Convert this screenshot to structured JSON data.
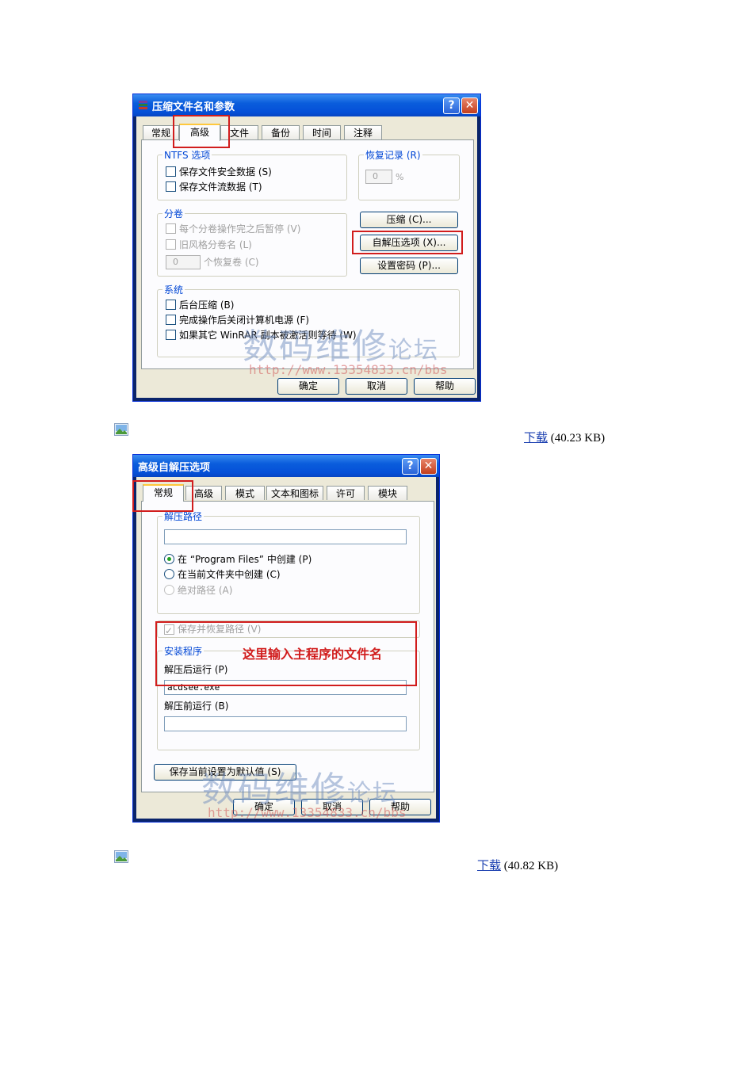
{
  "dialog1": {
    "title": "压缩文件名和参数",
    "help_glyph": "?",
    "close_glyph": "✕",
    "tabs": [
      "常规",
      "高级",
      "文件",
      "备份",
      "时间",
      "注释"
    ],
    "active_tab": "高级",
    "ntfs": {
      "label": "NTFS 选项",
      "options": [
        "保存文件安全数据 (S)",
        "保存文件流数据 (T)"
      ]
    },
    "recovery": {
      "label": "恢复记录 (R)",
      "value": "0",
      "unit": "%"
    },
    "volume": {
      "label": "分卷",
      "options": [
        "每个分卷操作完之后暂停 (V)",
        "旧风格分卷名 (L)"
      ],
      "spinner_value": "0",
      "spinner_label": "个恢复卷 (C)"
    },
    "side_buttons": [
      "压缩 (C)...",
      "自解压选项 (X)...",
      "设置密码 (P)..."
    ],
    "system": {
      "label": "系统",
      "options": [
        "后台压缩 (B)",
        "完成操作后关闭计算机电源 (F)",
        "如果其它 WinRAR 副本被激活则等待 (W)"
      ]
    },
    "footer": [
      "确定",
      "取消",
      "帮助"
    ]
  },
  "watermark": {
    "text": "数码维修",
    "suffix": "论坛",
    "url": "http://www.13354833.cn/bbs"
  },
  "attachment1": {
    "link": "下载",
    "size": "(40.23 KB)"
  },
  "dialog2": {
    "title": "高级自解压选项",
    "help_glyph": "?",
    "close_glyph": "✕",
    "tabs": [
      "常规",
      "高级",
      "模式",
      "文本和图标",
      "许可",
      "模块"
    ],
    "active_tab": "常规",
    "extract_path": {
      "label": "解压路径",
      "value": "",
      "radios": [
        "在 “Program Files” 中创建 (P)",
        "在当前文件夹中创建 (C)",
        "绝对路径 (A)"
      ]
    },
    "save_restore": "保存并恢复路径 (V)",
    "setup": {
      "label": "安装程序",
      "run_after_label": "解压后运行 (P)",
      "run_after_value": "acdsee.exe",
      "run_before_label": "解压前运行 (B)",
      "run_before_value": "",
      "annotation": "这里输入主程序的文件名"
    },
    "save_defaults": "保存当前设置为默认值 (S)",
    "footer": [
      "确定",
      "取消",
      "帮助"
    ]
  },
  "attachment2": {
    "link": "下载",
    "size": "(40.82 KB)"
  },
  "colors": {
    "annotation_red": "#d11d1d",
    "link_blue": "#1a3fb0",
    "xp_blue": "#0a5ddc"
  }
}
